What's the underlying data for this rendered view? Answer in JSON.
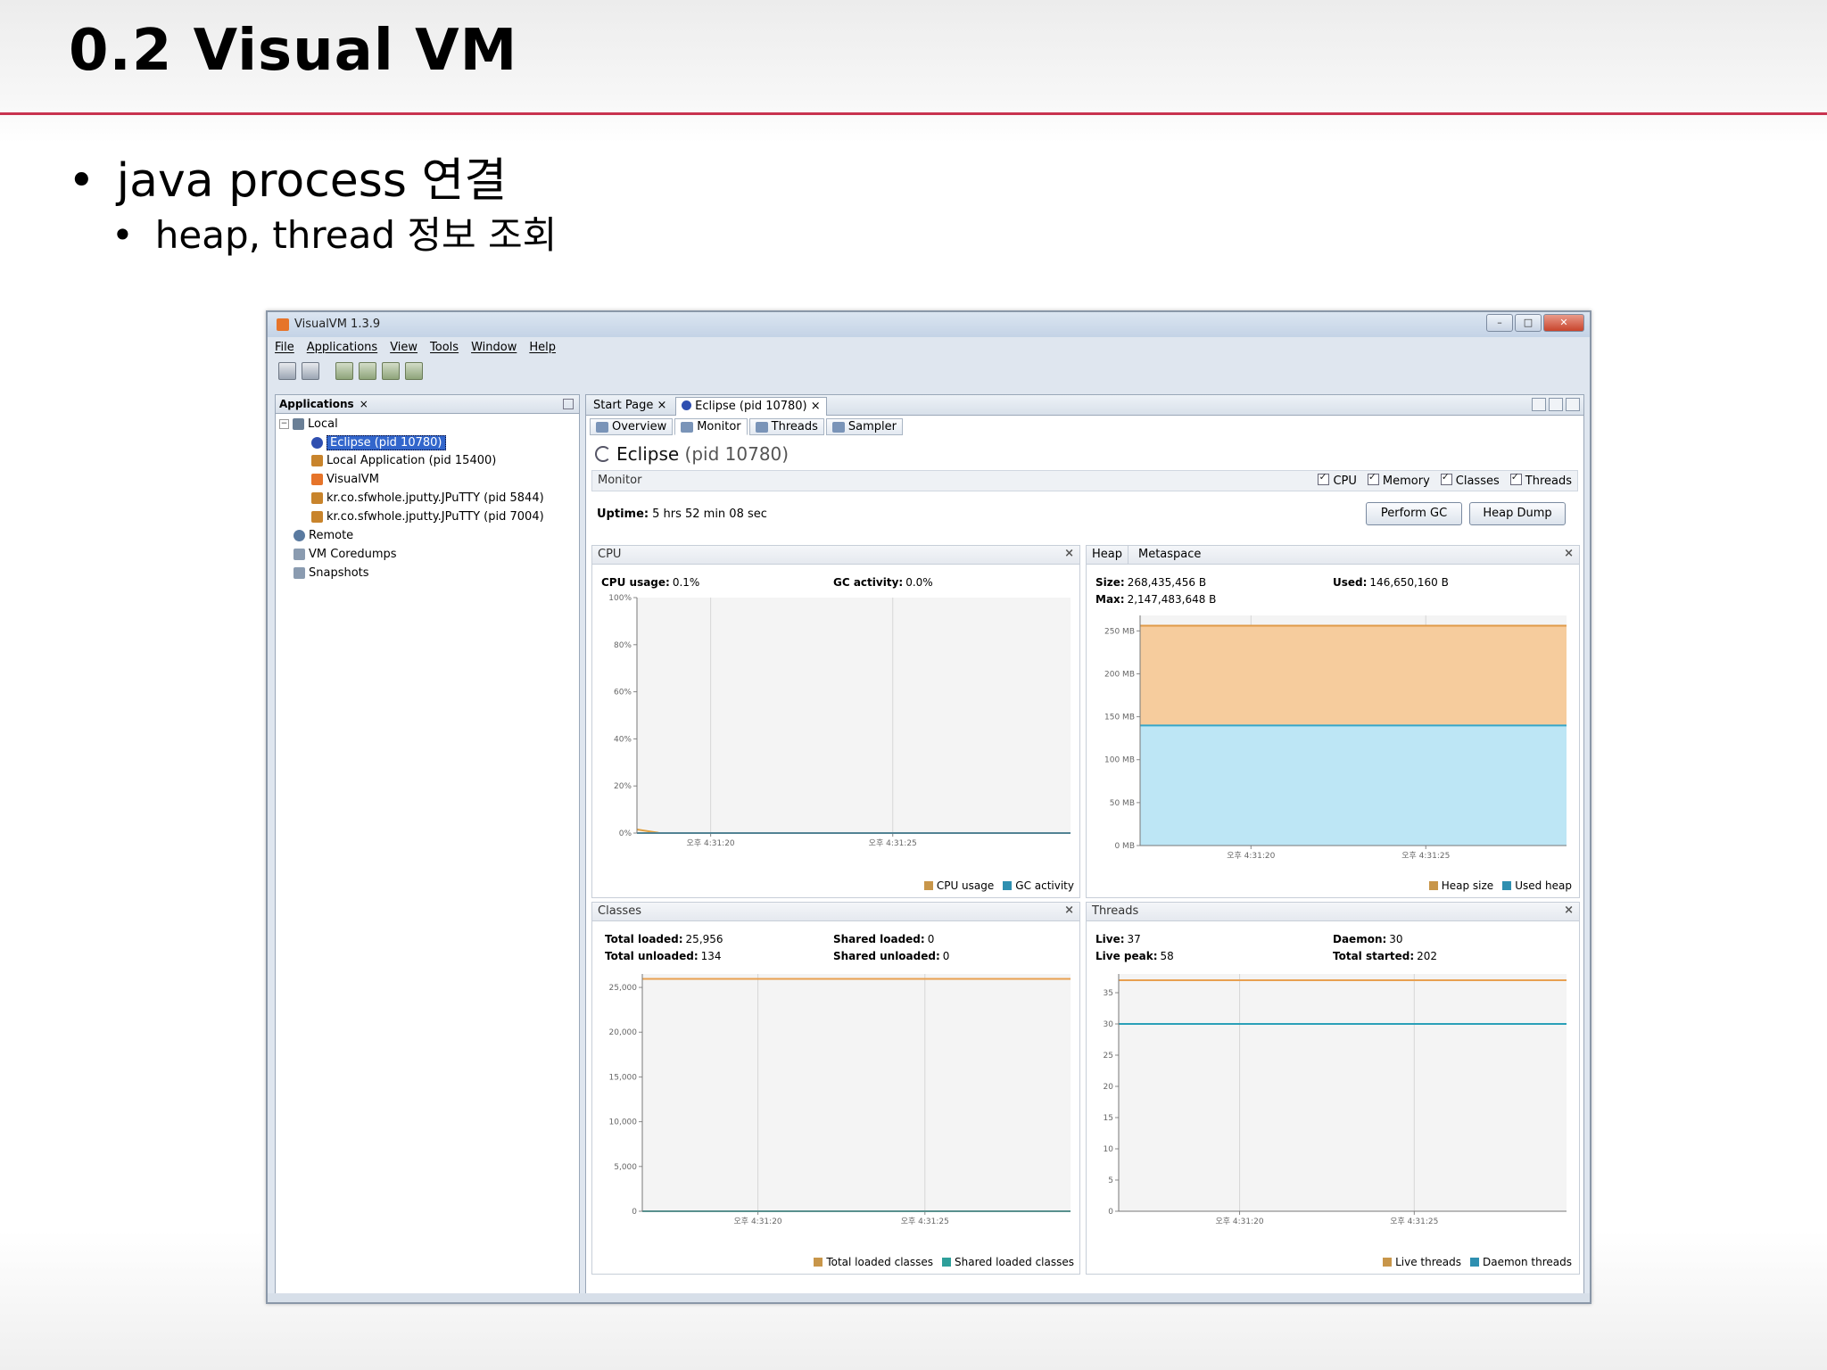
{
  "slide": {
    "title": "0.2 Visual VM",
    "bullet1": "java process 연결",
    "bullet2": "heap, thread 정보 조회"
  },
  "window": {
    "title": "VisualVM 1.3.9",
    "menu": [
      "File",
      "Applications",
      "View",
      "Tools",
      "Window",
      "Help"
    ]
  },
  "applications": {
    "tab_label": "Applications",
    "tree": {
      "local": "Local",
      "eclipse": "Eclipse (pid 10780)",
      "local_app": "Local Application (pid 15400)",
      "visualvm": "VisualVM",
      "putty1": "kr.co.sfwhole.jputty.JPuTTY (pid 5844)",
      "putty2": "kr.co.sfwhole.jputty.JPuTTY (pid 7004)",
      "remote": "Remote",
      "coredumps": "VM Coredumps",
      "snapshots": "Snapshots"
    }
  },
  "main": {
    "tabs": [
      "Start Page",
      "Eclipse (pid 10780)"
    ],
    "subtabs": [
      "Overview",
      "Monitor",
      "Threads",
      "Sampler"
    ],
    "process_name": "Eclipse",
    "process_pid": "(pid 10780)",
    "monitor_label": "Monitor",
    "checks": [
      "CPU",
      "Memory",
      "Classes",
      "Threads"
    ],
    "uptime_label": "Uptime:",
    "uptime_value": "5 hrs 52 min 08 sec",
    "perform_gc": "Perform GC",
    "heap_dump": "Heap Dump"
  },
  "cpu": {
    "title": "CPU",
    "usage_label": "CPU usage:",
    "usage_value": "0.1%",
    "gc_label": "GC activity:",
    "gc_value": "0.0%",
    "legend": [
      "CPU usage",
      "GC activity"
    ],
    "colors": {
      "cpu": "#e0a040",
      "gc": "#2e8fb0"
    }
  },
  "heap": {
    "tabs": [
      "Heap",
      "Metaspace"
    ],
    "size_label": "Size:",
    "size_value": "268,435,456 B",
    "max_label": "Max:",
    "max_value": "2,147,483,648 B",
    "used_label": "Used:",
    "used_value": "146,650,160 B",
    "legend": [
      "Heap size",
      "Used heap"
    ],
    "colors": {
      "size": "#f5c99a",
      "used": "#b8e4f4"
    }
  },
  "classes": {
    "title": "Classes",
    "total_loaded_label": "Total loaded:",
    "total_loaded_value": "25,956",
    "total_unloaded_label": "Total unloaded:",
    "total_unloaded_value": "134",
    "shared_loaded_label": "Shared loaded:",
    "shared_loaded_value": "0",
    "shared_unloaded_label": "Shared unloaded:",
    "shared_unloaded_value": "0",
    "legend": [
      "Total loaded classes",
      "Shared loaded classes"
    ]
  },
  "threads": {
    "title": "Threads",
    "live_label": "Live:",
    "live_value": "37",
    "live_peak_label": "Live peak:",
    "live_peak_value": "58",
    "daemon_label": "Daemon:",
    "daemon_value": "30",
    "total_started_label": "Total started:",
    "total_started_value": "202",
    "legend": [
      "Live threads",
      "Daemon threads"
    ]
  },
  "chart_data": [
    {
      "type": "line",
      "name": "CPU",
      "x_ticks": [
        "오후 4:31:20",
        "오후 4:31:25"
      ],
      "y_ticks": [
        "0%",
        "20%",
        "40%",
        "60%",
        "80%",
        "100%"
      ],
      "ylim": [
        0,
        100
      ],
      "series": [
        {
          "name": "CPU usage",
          "values": [
            1.5,
            0.1,
            0.1,
            0.1
          ]
        },
        {
          "name": "GC activity",
          "values": [
            0,
            0,
            0,
            0
          ]
        }
      ]
    },
    {
      "type": "area",
      "name": "Heap",
      "x_ticks": [
        "오후 4:31:20",
        "오후 4:31:25"
      ],
      "y_ticks": [
        "0 MB",
        "50 MB",
        "100 MB",
        "150 MB",
        "200 MB",
        "250 MB"
      ],
      "ylim": [
        0,
        268
      ],
      "series": [
        {
          "name": "Heap size",
          "values": [
            256,
            256,
            256,
            256
          ]
        },
        {
          "name": "Used heap",
          "values": [
            139.8,
            139.8,
            139.9,
            139.9
          ]
        }
      ]
    },
    {
      "type": "line",
      "name": "Classes",
      "x_ticks": [
        "오후 4:31:20",
        "오후 4:31:25"
      ],
      "y_ticks": [
        "0",
        "5,000",
        "10,000",
        "15,000",
        "20,000",
        "25,000"
      ],
      "ylim": [
        0,
        26500
      ],
      "series": [
        {
          "name": "Total loaded classes",
          "values": [
            25956,
            25956,
            25956,
            25956
          ]
        },
        {
          "name": "Shared loaded classes",
          "values": [
            0,
            0,
            0,
            0
          ]
        }
      ]
    },
    {
      "type": "line",
      "name": "Threads",
      "x_ticks": [
        "오후 4:31:20",
        "오후 4:31:25"
      ],
      "y_ticks": [
        "0",
        "5",
        "10",
        "15",
        "20",
        "25",
        "30",
        "35"
      ],
      "ylim": [
        0,
        38
      ],
      "series": [
        {
          "name": "Live threads",
          "values": [
            37,
            37,
            37,
            37
          ]
        },
        {
          "name": "Daemon threads",
          "values": [
            30,
            30,
            30,
            30
          ]
        }
      ]
    }
  ]
}
